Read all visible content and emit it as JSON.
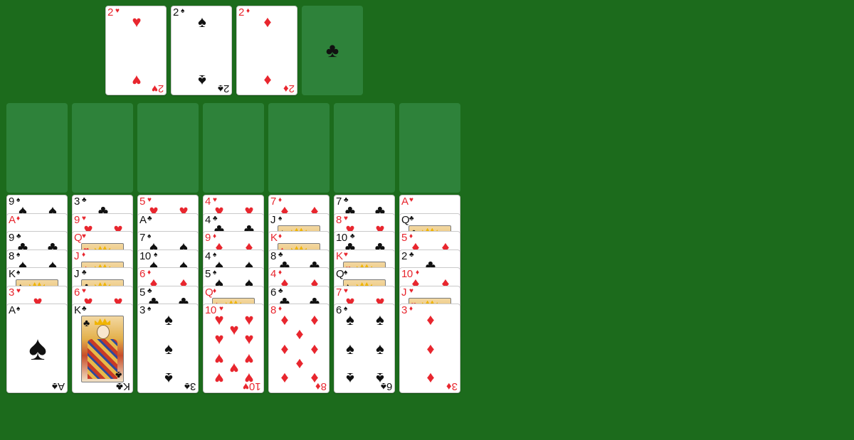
{
  "colors": {
    "table": "#1c6b1c",
    "slot": "#2e823a",
    "red": "#e8262e",
    "black": "#111111"
  },
  "foundations": [
    {
      "card": {
        "rank": "2",
        "suit": "hearts"
      }
    },
    {
      "card": {
        "rank": "2",
        "suit": "spades"
      }
    },
    {
      "card": {
        "rank": "2",
        "suit": "diamonds"
      }
    },
    {
      "card": null,
      "placeholder_suit": "clubs"
    }
  ],
  "freecells": [
    null,
    null,
    null,
    null,
    null,
    null,
    null
  ],
  "tableau": [
    [
      {
        "rank": "9",
        "suit": "spades"
      },
      {
        "rank": "A",
        "suit": "diamonds"
      },
      {
        "rank": "9",
        "suit": "clubs"
      },
      {
        "rank": "8",
        "suit": "spades"
      },
      {
        "rank": "K",
        "suit": "spades"
      },
      {
        "rank": "3",
        "suit": "hearts"
      },
      {
        "rank": "A",
        "suit": "spades"
      }
    ],
    [
      {
        "rank": "3",
        "suit": "clubs"
      },
      {
        "rank": "9",
        "suit": "hearts"
      },
      {
        "rank": "Q",
        "suit": "hearts"
      },
      {
        "rank": "J",
        "suit": "diamonds"
      },
      {
        "rank": "J",
        "suit": "clubs"
      },
      {
        "rank": "6",
        "suit": "hearts"
      },
      {
        "rank": "K",
        "suit": "clubs"
      }
    ],
    [
      {
        "rank": "5",
        "suit": "hearts"
      },
      {
        "rank": "A",
        "suit": "clubs"
      },
      {
        "rank": "7",
        "suit": "spades"
      },
      {
        "rank": "10",
        "suit": "spades"
      },
      {
        "rank": "6",
        "suit": "diamonds"
      },
      {
        "rank": "5",
        "suit": "clubs"
      },
      {
        "rank": "3",
        "suit": "spades"
      }
    ],
    [
      {
        "rank": "4",
        "suit": "hearts"
      },
      {
        "rank": "4",
        "suit": "clubs"
      },
      {
        "rank": "9",
        "suit": "diamonds"
      },
      {
        "rank": "4",
        "suit": "spades"
      },
      {
        "rank": "5",
        "suit": "spades"
      },
      {
        "rank": "Q",
        "suit": "diamonds"
      },
      {
        "rank": "10",
        "suit": "hearts"
      }
    ],
    [
      {
        "rank": "7",
        "suit": "diamonds"
      },
      {
        "rank": "J",
        "suit": "spades"
      },
      {
        "rank": "K",
        "suit": "diamonds"
      },
      {
        "rank": "8",
        "suit": "clubs"
      },
      {
        "rank": "4",
        "suit": "diamonds"
      },
      {
        "rank": "6",
        "suit": "clubs"
      },
      {
        "rank": "8",
        "suit": "diamonds"
      }
    ],
    [
      {
        "rank": "7",
        "suit": "clubs"
      },
      {
        "rank": "8",
        "suit": "hearts"
      },
      {
        "rank": "10",
        "suit": "clubs"
      },
      {
        "rank": "K",
        "suit": "hearts"
      },
      {
        "rank": "Q",
        "suit": "spades"
      },
      {
        "rank": "7",
        "suit": "hearts"
      },
      {
        "rank": "6",
        "suit": "spades"
      }
    ],
    [
      {
        "rank": "A",
        "suit": "hearts"
      },
      {
        "rank": "Q",
        "suit": "clubs"
      },
      {
        "rank": "5",
        "suit": "diamonds"
      },
      {
        "rank": "2",
        "suit": "clubs"
      },
      {
        "rank": "10",
        "suit": "diamonds"
      },
      {
        "rank": "J",
        "suit": "hearts"
      },
      {
        "rank": "3",
        "suit": "diamonds"
      }
    ]
  ]
}
